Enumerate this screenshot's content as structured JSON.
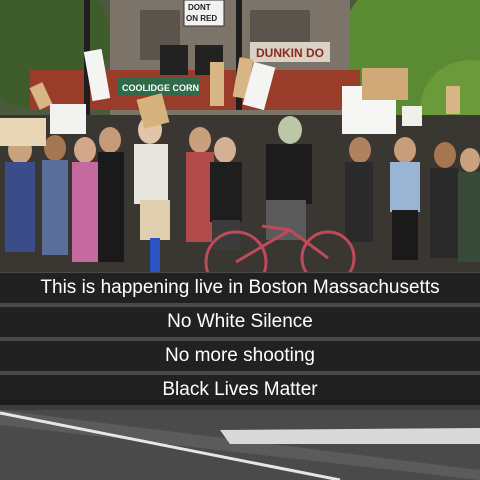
{
  "scene": {
    "street_sign": "DONT\nON RED",
    "store_sign": "COOLIDGE CORN",
    "store_sign_right": "DUNKIN DO"
  },
  "captions": [
    "This is happening live in Boston Massachusetts",
    "No White Silence",
    "No more shooting",
    "Black Lives Matter"
  ]
}
